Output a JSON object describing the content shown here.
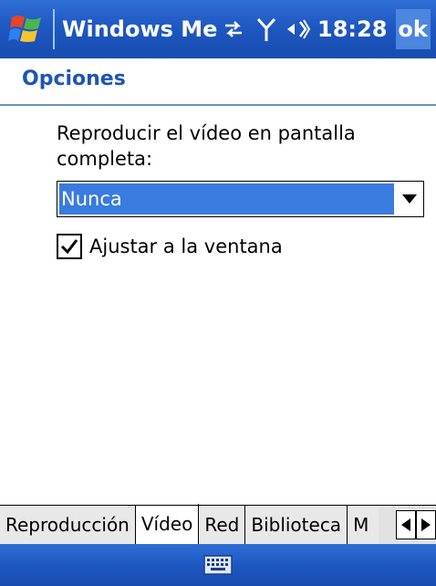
{
  "titlebar": {
    "app_title": "Windows Medi",
    "time": "18:28",
    "ok_label": "ok"
  },
  "page": {
    "title": "Opciones",
    "fullscreen_label": "Reproducir el vídeo en pantalla completa:",
    "fullscreen_selected": "Nunca",
    "fit_window_label": "Ajustar a la ventana",
    "fit_window_checked": true
  },
  "tabs": [
    {
      "label": "Reproducción"
    },
    {
      "label": "Vídeo"
    },
    {
      "label": "Red"
    },
    {
      "label": "Biblioteca"
    },
    {
      "label": "M"
    }
  ],
  "icons": {
    "start": "windows-flag-icon",
    "connectivity": "sync-arrows-icon",
    "signal": "antenna-icon",
    "volume": "speaker-icon",
    "keyboard": "keyboard-icon"
  },
  "colors": {
    "accent_blue": "#1f58c2",
    "header_text": "#1e55b7",
    "selection": "#3a7be0"
  }
}
